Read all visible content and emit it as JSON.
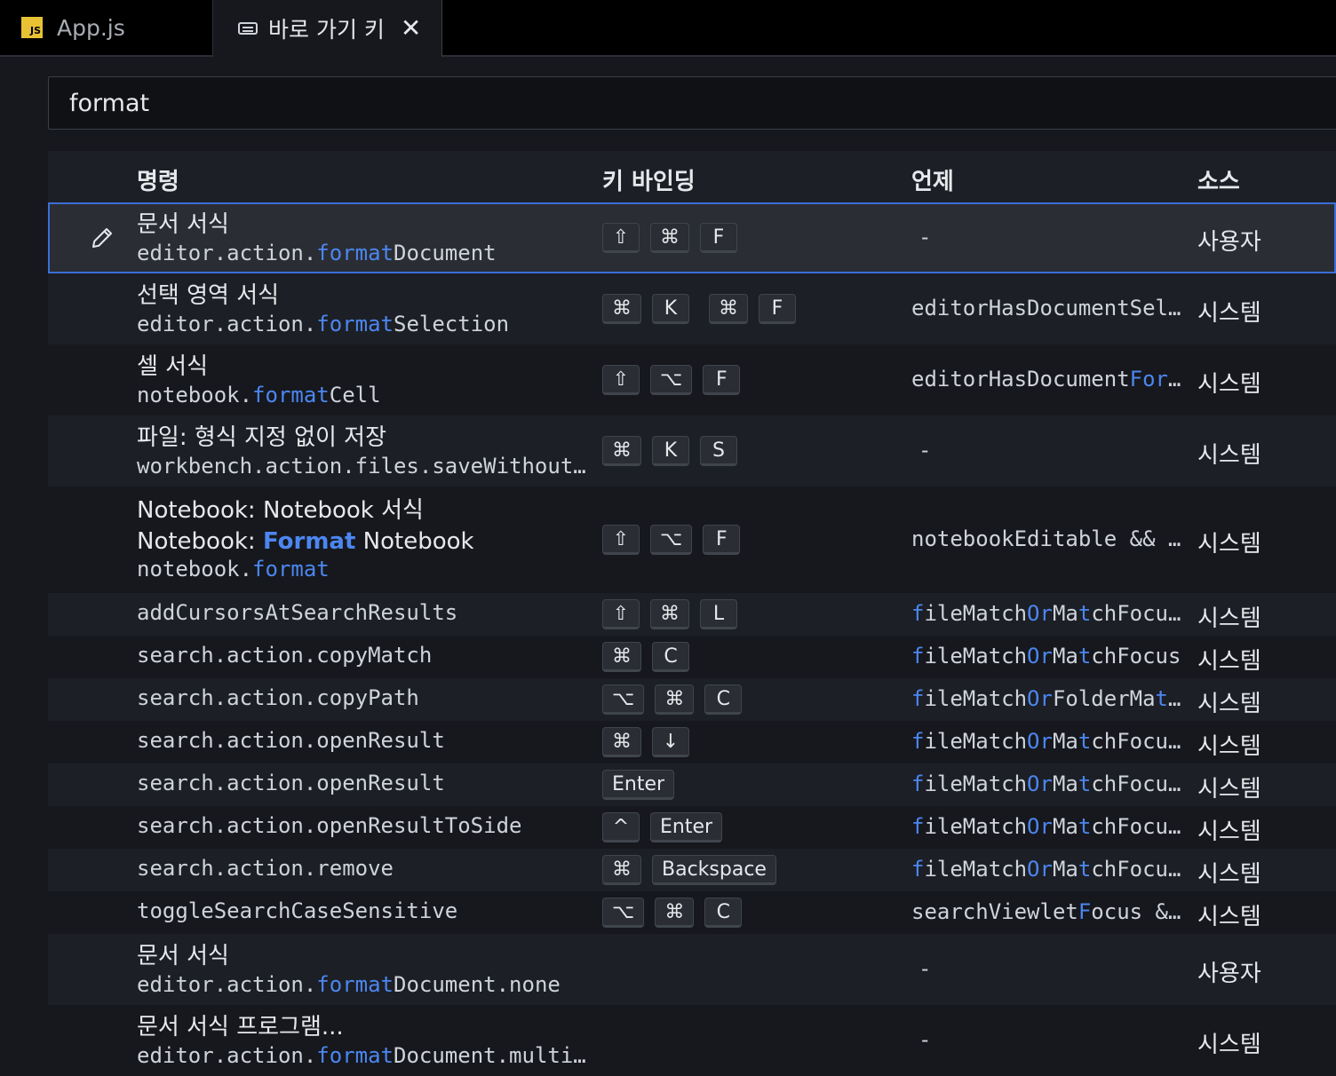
{
  "tabs": [
    {
      "badge": "JS",
      "label": "App.js"
    },
    {
      "label": "바로 가기 키"
    }
  ],
  "search": {
    "value": "format"
  },
  "columns": {
    "command": "명령",
    "keybinding": "키 바인딩",
    "when": "언제",
    "source": "소스"
  },
  "rows": [
    {
      "title": "문서 서식",
      "id_pre": "editor.action.",
      "id_hl": "format",
      "id_post": "Document",
      "keys": [
        "⇧",
        "⌘",
        "F"
      ],
      "when": "-",
      "source": "사용자"
    },
    {
      "title": "선택 영역 서식",
      "id_pre": "editor.action.",
      "id_hl": "format",
      "id_post": "Selection",
      "keys": [
        "⌘",
        "K"
      ],
      "keys2": [
        "⌘",
        "F"
      ],
      "when": "editorHasDocumentSel…",
      "source": "시스템"
    },
    {
      "title": "셀 서식",
      "id_pre": "notebook.",
      "id_hl": "format",
      "id_post": "Cell",
      "keys": [
        "⇧",
        "⌥",
        "F"
      ],
      "when_pre": "editorHasDocument",
      "when_hl": "For",
      "when_post": "…",
      "source": "시스템"
    },
    {
      "title": "파일: 형식 지정 없이 저장",
      "id_pre": "workbench.action.files.saveWithout…",
      "keys": [
        "⌘",
        "K",
        "S"
      ],
      "when": "-",
      "source": "시스템"
    },
    {
      "title": "Notebook: Notebook 서식",
      "sub_pre": "Notebook: ",
      "sub_hl": "Format",
      "sub_post": " Notebook",
      "id_pre": "notebook.",
      "id_hl": "format",
      "keys": [
        "⇧",
        "⌥",
        "F"
      ],
      "when": "notebookEditable && …",
      "source": "시스템"
    },
    {
      "id_pre": "addCursorsAtSearchResults",
      "keys": [
        "⇧",
        "⌘",
        "L"
      ],
      "w": [
        "f",
        "ileMatch",
        "Or",
        "Ma",
        "t",
        "chFocu…"
      ],
      "source": "시스템"
    },
    {
      "id_pre": "search.action.copyMatch",
      "keys": [
        "⌘",
        "C"
      ],
      "w": [
        "f",
        "ileMatch",
        "Or",
        "Ma",
        "t",
        "chFocus"
      ],
      "source": "시스템"
    },
    {
      "id_pre": "search.action.copyPath",
      "keys": [
        "⌥",
        "⌘",
        "C"
      ],
      "w": [
        "f",
        "ileMatch",
        "Or",
        "FolderMa",
        "t",
        "…"
      ],
      "source": "시스템"
    },
    {
      "id_pre": "search.action.openResult",
      "keys": [
        "⌘",
        "↓"
      ],
      "w": [
        "f",
        "ileMatch",
        "Or",
        "Ma",
        "t",
        "chFocu…"
      ],
      "source": "시스템"
    },
    {
      "id_pre": "search.action.openResult",
      "keys": [
        "Enter"
      ],
      "w": [
        "f",
        "ileMatch",
        "Or",
        "Ma",
        "t",
        "chFocu…"
      ],
      "source": "시스템"
    },
    {
      "id_pre": "search.action.openResultToSide",
      "keys": [
        "^",
        "Enter"
      ],
      "w": [
        "f",
        "ileMatch",
        "Or",
        "Ma",
        "t",
        "chFocu…"
      ],
      "source": "시스템"
    },
    {
      "id_pre": "search.action.remove",
      "keys": [
        "⌘",
        "Backspace"
      ],
      "w": [
        "f",
        "ileMatch",
        "Or",
        "Ma",
        "t",
        "chFocu…"
      ],
      "source": "시스템"
    },
    {
      "id_pre": "toggleSearchCaseSensitive",
      "keys": [
        "⌥",
        "⌘",
        "C"
      ],
      "when_pre": "searchViewlet",
      "when_hl": "F",
      "when_post": "ocus &…",
      "source": "시스템"
    },
    {
      "title": "문서 서식",
      "id_pre": "editor.action.",
      "id_hl": "format",
      "id_post": "Document.none",
      "when": "-",
      "source": "사용자"
    },
    {
      "title": "문서 서식 프로그램...",
      "id_pre": "editor.action.",
      "id_hl": "format",
      "id_post": "Document.multi…",
      "when": "-",
      "source": "시스템"
    }
  ]
}
